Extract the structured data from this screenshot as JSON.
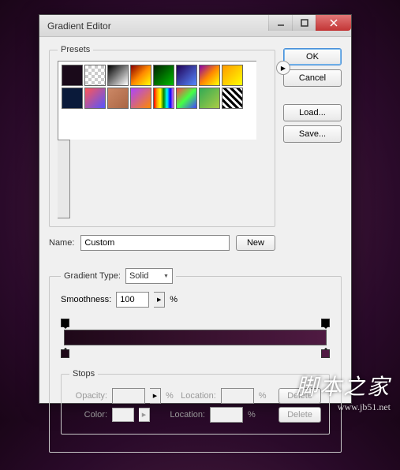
{
  "window": {
    "title": "Gradient Editor"
  },
  "buttons": {
    "ok": "OK",
    "cancel": "Cancel",
    "load": "Load...",
    "save": "Save...",
    "new": "New",
    "delete": "Delete"
  },
  "presets": {
    "legend": "Presets"
  },
  "name": {
    "label": "Name:",
    "value": "Custom"
  },
  "gradient": {
    "type_label": "Gradient Type:",
    "type_value": "Solid",
    "smoothness_label": "Smoothness:",
    "smoothness_value": "100",
    "smoothness_unit": "%",
    "bar_gradient": "linear-gradient(to right, #1e0818 0%, #4f1a42 100%)",
    "color_left": "#1e0818",
    "color_right": "#4f1a42"
  },
  "stops": {
    "legend": "Stops",
    "opacity_label": "Opacity:",
    "location_label": "Location:",
    "color_label": "Color:",
    "pct": "%"
  },
  "watermark": {
    "cn": "脚本之家",
    "url": "www.jb51.net"
  }
}
